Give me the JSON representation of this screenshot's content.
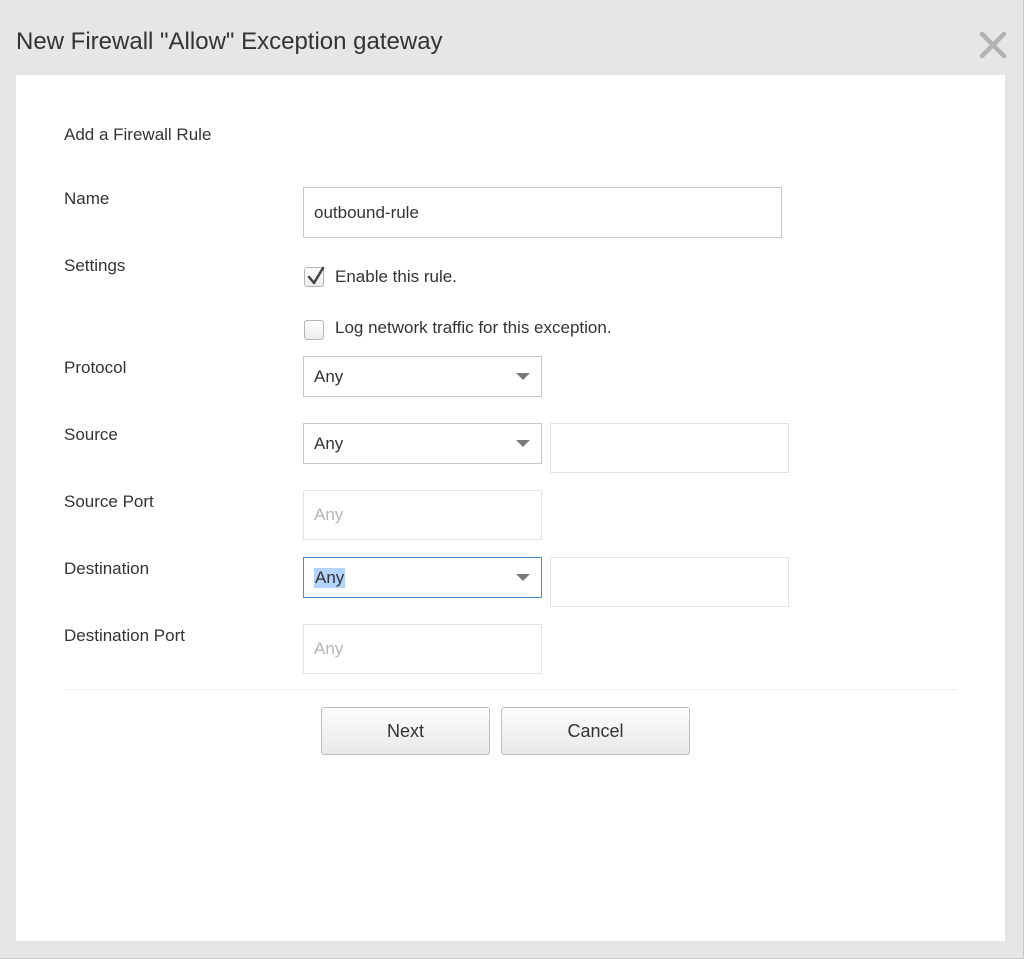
{
  "dialog": {
    "title": "New Firewall \"Allow\" Exception gateway",
    "close_icon": "close-icon"
  },
  "form": {
    "section_title": "Add a Firewall Rule",
    "name": {
      "label": "Name",
      "value": "outbound-rule"
    },
    "settings": {
      "label": "Settings",
      "enable_rule": {
        "label": "Enable this rule.",
        "checked": true
      },
      "log_traffic": {
        "label": "Log network traffic for this exception.",
        "checked": false
      }
    },
    "protocol": {
      "label": "Protocol",
      "selected": "Any"
    },
    "source": {
      "label": "Source",
      "selected": "Any",
      "value": ""
    },
    "source_port": {
      "label": "Source Port",
      "placeholder": "Any"
    },
    "destination": {
      "label": "Destination",
      "selected": "Any",
      "value": ""
    },
    "destination_port": {
      "label": "Destination Port",
      "placeholder": "Any"
    }
  },
  "buttons": {
    "next": "Next",
    "cancel": "Cancel"
  },
  "colors": {
    "focus_border": "#3d8fd6",
    "selection_highlight": "#b3d4fc",
    "dialog_background": "#e6e6e6"
  }
}
